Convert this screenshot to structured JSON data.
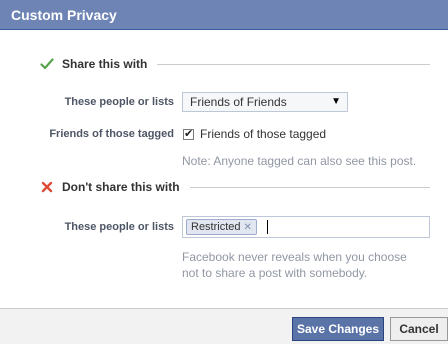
{
  "dialog": {
    "title": "Custom Privacy"
  },
  "share_section": {
    "heading": "Share this with",
    "icon": "check-icon",
    "icon_color": "#55a34a",
    "people_label": "These people or lists",
    "people_select_value": "Friends of Friends",
    "tagged_label": "Friends of those tagged",
    "tagged_checkbox_label": "Friends of those tagged",
    "tagged_checked": true,
    "note": "Note: Anyone tagged can also see this post."
  },
  "dont_share_section": {
    "heading": "Don't share this with",
    "icon": "cross-icon",
    "icon_color": "#dd4b39",
    "people_label": "These people or lists",
    "tokens": [
      "Restricted"
    ],
    "note_line1": "Facebook never reveals when you choose",
    "note_line2": "not to share a post with somebody."
  },
  "footer": {
    "save_label": "Save Changes",
    "cancel_label": "Cancel"
  },
  "colors": {
    "titlebar": "#6d84b4",
    "save_button": "#5b74a8"
  }
}
